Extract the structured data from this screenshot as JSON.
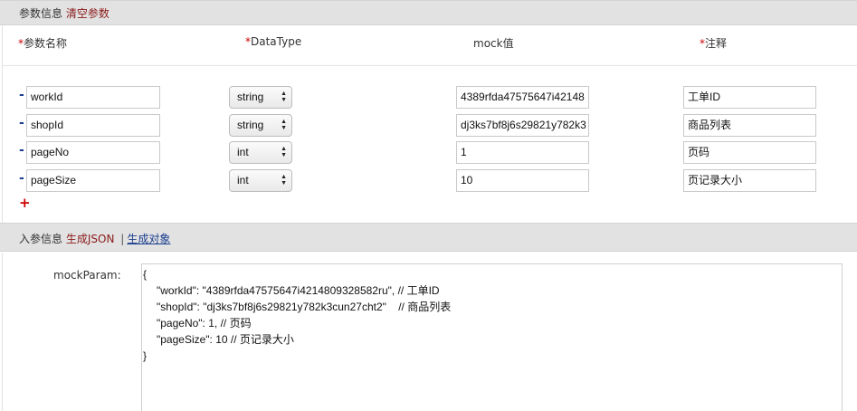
{
  "param_section": {
    "title": "参数信息",
    "clear_link": "清空参数",
    "columns": {
      "name": "参数名称",
      "datatype": "DataType",
      "mock": "mock值",
      "note": "注释"
    },
    "required_mark": "*",
    "remove_symbol": "-",
    "add_symbol": "+",
    "rows": [
      {
        "name": "workId",
        "type": "string",
        "mock": "4389rfda47575647i42148",
        "note": "工单ID"
      },
      {
        "name": "shopId",
        "type": "string",
        "mock": "dj3ks7bf8j6s29821y782k3",
        "note": "商品列表"
      },
      {
        "name": "pageNo",
        "type": "int",
        "mock": "1",
        "note": "页码"
      },
      {
        "name": "pageSize",
        "type": "int",
        "mock": "10",
        "note": "页记录大小"
      }
    ]
  },
  "input_section": {
    "title": "入参信息",
    "gen_json": "生成JSON",
    "separator": "|",
    "gen_object": "生成对象",
    "mock_label": "mockParam:",
    "json_lines": [
      "{",
      "\"workId\": \"4389rfda47575647i4214809328582ru\", // 工单ID",
      "\"shopId\": \"dj3ks7bf8j6s29821y782k3cun27cht2\"    // 商品列表",
      "\"pageNo\": 1, // 页码",
      "\"pageSize\": 10 // 页记录大小",
      "}"
    ]
  }
}
